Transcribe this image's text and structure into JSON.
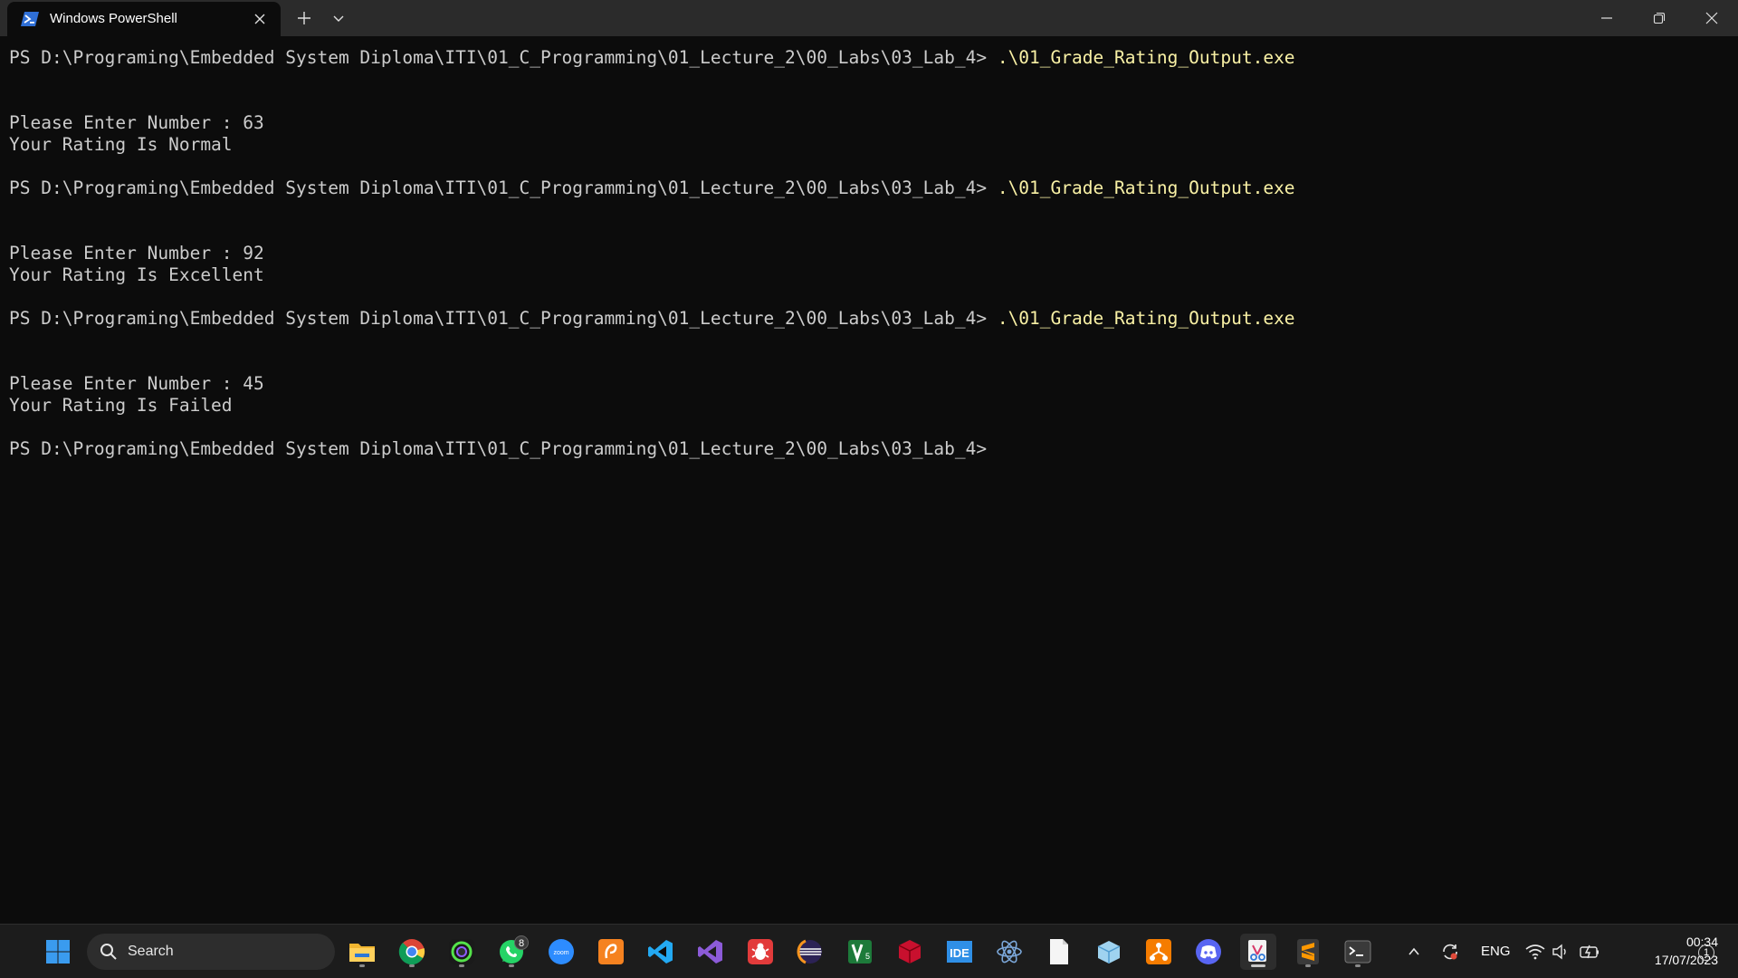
{
  "window": {
    "tab_title": "Windows PowerShell"
  },
  "console": {
    "lines": [
      {
        "prompt": "PS D:\\Programing\\Embedded System Diploma\\ITI\\01_C_Programming\\01_Lecture_2\\00_Labs\\03_Lab_4> ",
        "command": ".\\01_Grade_Rating_Output.exe"
      },
      {
        "text": "Please Enter Number : 63"
      },
      {
        "text": "Your Rating Is Normal"
      },
      {
        "prompt": "PS D:\\Programing\\Embedded System Diploma\\ITI\\01_C_Programming\\01_Lecture_2\\00_Labs\\03_Lab_4> ",
        "command": ".\\01_Grade_Rating_Output.exe"
      },
      {
        "text": "Please Enter Number : 92"
      },
      {
        "text": "Your Rating Is Excellent"
      },
      {
        "prompt": "PS D:\\Programing\\Embedded System Diploma\\ITI\\01_C_Programming\\01_Lecture_2\\00_Labs\\03_Lab_4> ",
        "command": ".\\01_Grade_Rating_Output.exe"
      },
      {
        "text": "Please Enter Number : 45"
      },
      {
        "text": "Your Rating Is Failed"
      },
      {
        "prompt": "PS D:\\Programing\\Embedded System Diploma\\ITI\\01_C_Programming\\01_Lecture_2\\00_Labs\\03_Lab_4>",
        "command": ""
      }
    ],
    "colors": {
      "text": "#cccccc",
      "command": "#f9f1a5",
      "background": "#0c0c0c"
    }
  },
  "taskbar": {
    "search_label": "Search",
    "apps": [
      {
        "name": "file-explorer-icon",
        "running": true
      },
      {
        "name": "chrome-icon",
        "running": true
      },
      {
        "name": "camera-app-icon",
        "running": true
      },
      {
        "name": "whatsapp-icon",
        "running": true,
        "badge": "8"
      },
      {
        "name": "zoom-icon",
        "running": false
      },
      {
        "name": "pdf-editor-icon",
        "running": false
      },
      {
        "name": "vscode-icon",
        "running": false
      },
      {
        "name": "visual-studio-icon",
        "running": false
      },
      {
        "name": "bug-tool-icon",
        "running": false
      },
      {
        "name": "eclipse-icon",
        "running": false
      },
      {
        "name": "v5-app-icon",
        "running": false
      },
      {
        "name": "3d-box-icon",
        "running": false
      },
      {
        "name": "ide-icon",
        "running": false
      },
      {
        "name": "atom-icon",
        "running": false
      },
      {
        "name": "blank-file-icon",
        "running": false
      },
      {
        "name": "box-app-icon",
        "running": false
      },
      {
        "name": "sublime-merge-icon",
        "running": false
      },
      {
        "name": "discord-icon",
        "running": false
      },
      {
        "name": "snipping-tool-icon",
        "running": true,
        "active": true
      },
      {
        "name": "sublime-text-icon",
        "running": true
      },
      {
        "name": "terminal-icon",
        "running": true
      }
    ],
    "tray": {
      "language": "ENG",
      "time": "00:34",
      "date": "17/07/2023",
      "notifications": "1"
    }
  }
}
